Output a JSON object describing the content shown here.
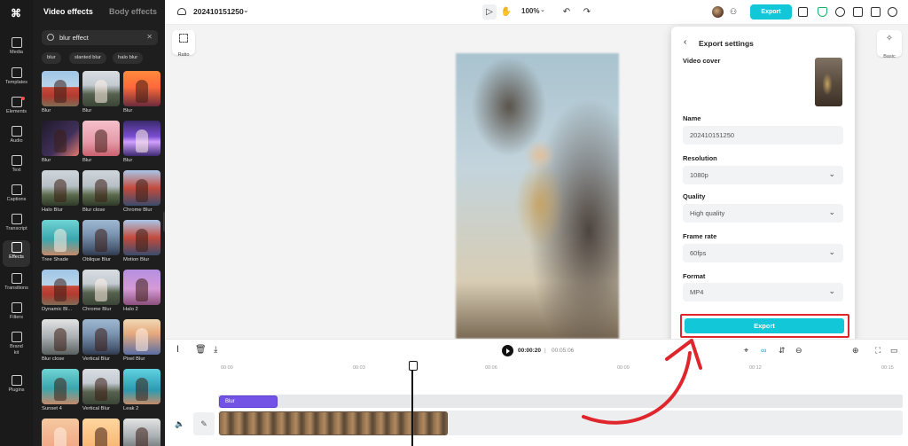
{
  "rail": {
    "items": [
      {
        "label": "Media"
      },
      {
        "label": "Templates"
      },
      {
        "label": "Elements"
      },
      {
        "label": "Audio"
      },
      {
        "label": "Text"
      },
      {
        "label": "Captions"
      },
      {
        "label": "Transcript"
      },
      {
        "label": "Effects"
      },
      {
        "label": "Transitions"
      },
      {
        "label": "Filters"
      },
      {
        "label": "Brand kit"
      },
      {
        "label": "Plugins"
      }
    ]
  },
  "effects_panel": {
    "tabs": [
      {
        "label": "Video effects"
      },
      {
        "label": "Body effects"
      }
    ],
    "search": {
      "value": "blur effect"
    },
    "chips": [
      {
        "label": "blur"
      },
      {
        "label": "slanted blur"
      },
      {
        "label": "halo blur"
      }
    ],
    "items": [
      {
        "label": "Blur",
        "style": "t-red"
      },
      {
        "label": "Blur",
        "style": "t-mist"
      },
      {
        "label": "Blur",
        "style": "t-orange"
      },
      {
        "label": "Blur",
        "style": "t-dark"
      },
      {
        "label": "Blur",
        "style": "t-pink"
      },
      {
        "label": "Blur",
        "style": "t-purple"
      },
      {
        "label": "Halo Blur",
        "style": "t-field"
      },
      {
        "label": "Blur close",
        "style": "t-field"
      },
      {
        "label": "Chrome Blur",
        "style": "t-motion"
      },
      {
        "label": "Tree Shade",
        "style": "t-teal"
      },
      {
        "label": "Oblique Blur",
        "style": "t-city"
      },
      {
        "label": "Motion Blur",
        "style": "t-motion"
      },
      {
        "label": "Dynamic Bl...",
        "style": "t-red"
      },
      {
        "label": "Chrome Blur",
        "style": "t-mist"
      },
      {
        "label": "Halo 2",
        "style": "t-lilac"
      },
      {
        "label": "Blur close",
        "style": "t-gray"
      },
      {
        "label": "Vertical Blur",
        "style": "t-city"
      },
      {
        "label": "Pixel Blur",
        "style": "t-sunset"
      },
      {
        "label": "Sunset 4",
        "style": "t-teal"
      },
      {
        "label": "Vertical Blur",
        "style": "t-mist"
      },
      {
        "label": "Leak 2",
        "style": "t-cyan"
      },
      {
        "label": "",
        "style": "t-peach"
      },
      {
        "label": "",
        "style": "t-warm"
      },
      {
        "label": "",
        "style": "t-gray"
      }
    ]
  },
  "topbar": {
    "project_name": "202410151250",
    "zoom": "100%",
    "export_label": "Export"
  },
  "canvas": {
    "ratio_label": "Ratio",
    "basic_label": "Basic"
  },
  "export_dialog": {
    "title": "Export settings",
    "video_cover_label": "Video cover",
    "name_label": "Name",
    "name_value": "202410151250",
    "resolution_label": "Resolution",
    "resolution_value": "1080p",
    "quality_label": "Quality",
    "quality_value": "High quality",
    "frame_rate_label": "Frame rate",
    "frame_rate_value": "60fps",
    "format_label": "Format",
    "format_value": "MP4",
    "export_button": "Export",
    "highlight_color": "#e0262d",
    "accent_color": "#12c7d8"
  },
  "timeline": {
    "current_time": "00:00:20",
    "separator": "|",
    "total_time": "00:05:06",
    "ticks": [
      "00:00",
      "00:03",
      "00:06",
      "00:09",
      "00:12",
      "00:15"
    ],
    "effect_clip_label": "Blur"
  }
}
